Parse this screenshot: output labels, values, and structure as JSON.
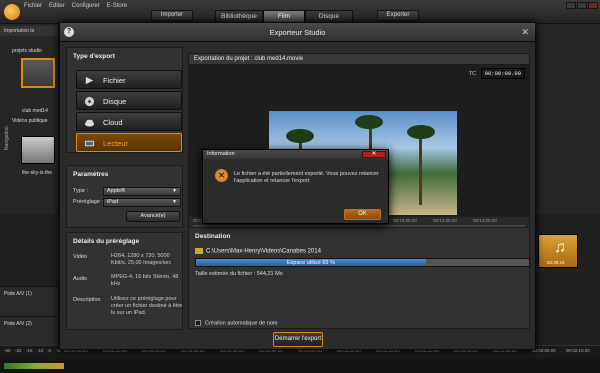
{
  "app": {
    "menu": [
      "Fichier",
      "Editer",
      "Configurer",
      "E-Store"
    ],
    "import_label": "Importer",
    "tabs": [
      "Bibliothèque",
      "Film",
      "Disque"
    ],
    "active_tab": "Film",
    "export_label": "Exporter",
    "breadcrumb": "Importation la",
    "tree_items": [
      "projets studio",
      "club med14",
      "Vidéos publique",
      "the-sky-is-the"
    ],
    "nav_label": "Navigation",
    "tracks": [
      "Piste A/V (1)",
      "Piste A/V (2)"
    ],
    "music_time": "02:49:24",
    "timeline_ticks": [
      "-60",
      "-22",
      "-16",
      "-10",
      "-6",
      "-3",
      "00:00:00.00",
      "00:00:10.00",
      "00:00:20.00",
      "00:00:30.00",
      "00:00:40.00",
      "00:00:50.00",
      "00:01:00.00",
      "00:01:10.00",
      "00:01:20.00",
      "00:01:30.00",
      "00:01:40.00",
      "00:01:50.00",
      "00:02:00.00",
      "00:02:10.00"
    ]
  },
  "dialog": {
    "title": "Exporteur Studio",
    "export_type": {
      "title": "Type d'export",
      "options": [
        "Fichier",
        "Disque",
        "Cloud",
        "Lecteur"
      ],
      "active": "Lecteur"
    },
    "params": {
      "title": "Paramètres",
      "type_label": "Type :",
      "type_value": "Apple®",
      "preset_label": "Préréglage :",
      "preset_value": "iPad",
      "advanced_label": "Avancé(e)"
    },
    "details": {
      "title": "Détails du préréglage",
      "video_label": "Vidéo",
      "video_value": "H264, 1280 x 720, 5000 Kbit/s, 25,00 Images/sec",
      "audio_label": "Audio",
      "audio_value": "MPEG-4, 16 bits Stéréo, 48 kHz",
      "desc_label": "Description",
      "desc_value": "Utilisez ce préréglage pour créer un fichier destiné à être lu sur un iPad."
    },
    "preview": {
      "title": "Exportation du projet : club med14.movie",
      "tc_label": "TC",
      "tc_value": "00:00:00.00",
      "scrub_ticks": [
        "00:00:00.00",
        "00:02:00.00",
        "00:04:00.00",
        "00:06:00.00",
        "00:08:00.00",
        "00:10:00.00",
        "00:12:00.00",
        "00:14:00.00"
      ]
    },
    "destination": {
      "title": "Destination",
      "path": "C:\\Users\\Max-Henry\\Videos\\Canabes 2014",
      "space_used_label": "Espace utilisé 69 %",
      "space_used_pct": 69,
      "size_estimate": "Taille estimée du fichier : 544,21 Mo",
      "auto_name_label": "Création automatique de nom"
    },
    "start_label": "Démarrer l'export"
  },
  "info": {
    "title": "Information",
    "message": "Le fichier a été partiellement exporté. Vous pouvez relancer l'application et relancer l'export",
    "ok_label": "OK",
    "close_label": "✕"
  },
  "colors": {
    "accent": "#e08a10",
    "progress": "#3a78c0",
    "error": "#b02020"
  }
}
